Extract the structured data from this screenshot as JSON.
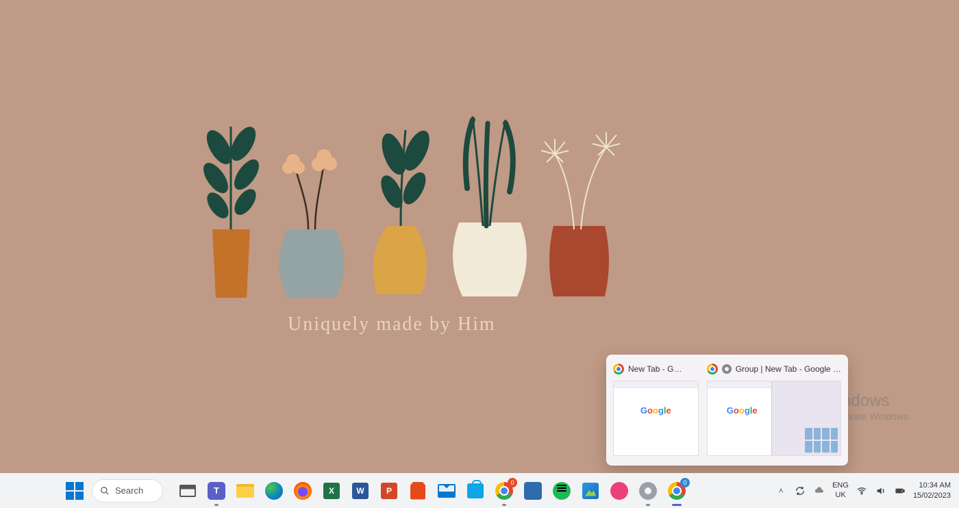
{
  "wallpaper": {
    "caption": "Uniquely made by Him"
  },
  "watermark": {
    "title": "Activate Windows",
    "subtitle": "Go to Settings to activate Windows."
  },
  "taskbar_preview": {
    "items": [
      {
        "title": "New Tab - G…",
        "logo_text": "Google"
      },
      {
        "title": "Group | New Tab - Google …",
        "logo_text": "Google"
      }
    ]
  },
  "search": {
    "placeholder": "Search"
  },
  "taskbar_apps": [
    {
      "name": "task-view"
    },
    {
      "name": "teams"
    },
    {
      "name": "file-explorer"
    },
    {
      "name": "edge"
    },
    {
      "name": "firefox"
    },
    {
      "name": "excel",
      "letter": "X"
    },
    {
      "name": "word",
      "letter": "W"
    },
    {
      "name": "powerpoint",
      "letter": "P"
    },
    {
      "name": "office"
    },
    {
      "name": "mail"
    },
    {
      "name": "microsoft-store"
    },
    {
      "name": "chrome",
      "badge": "0"
    },
    {
      "name": "app-blue-1"
    },
    {
      "name": "spotify"
    },
    {
      "name": "photos"
    },
    {
      "name": "pink-app"
    },
    {
      "name": "settings"
    },
    {
      "name": "chrome-2",
      "badge": "0",
      "active": true
    }
  ],
  "system_tray": {
    "language_top": "ENG",
    "language_bottom": "UK",
    "time": "10:34 AM",
    "date": "15/02/2023"
  }
}
